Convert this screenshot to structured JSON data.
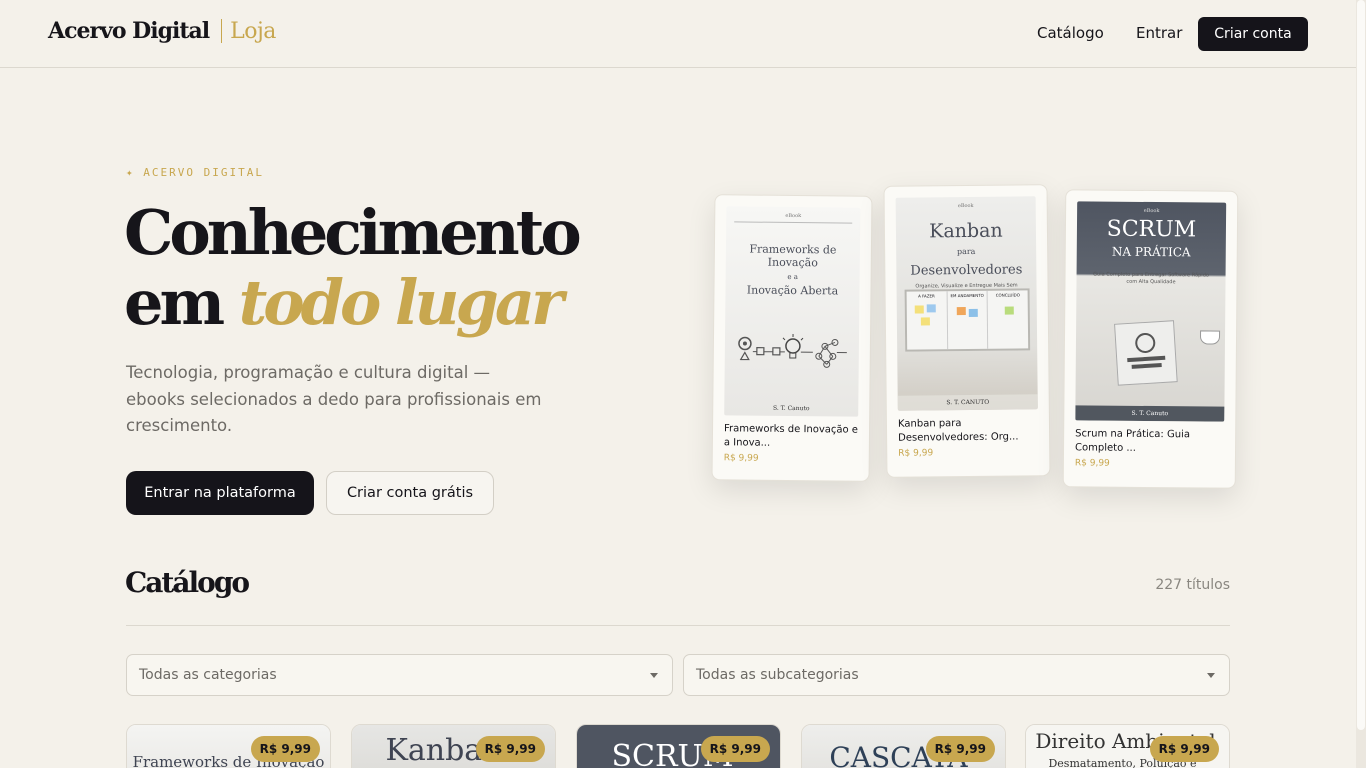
{
  "header": {
    "brand_name": "Acervo Digital",
    "brand_sub": "Loja",
    "nav": [
      {
        "label": "Catálogo"
      },
      {
        "label": "Entrar"
      }
    ],
    "cta_label": "Criar conta"
  },
  "hero": {
    "eyebrow": "✦ ACERVO DIGITAL",
    "title_line1": "Conhecimento",
    "title_line2_plain": "em ",
    "title_line2_accent": "todo lugar",
    "description": "Tecnologia, programação e cultura digital — ebooks selecionados a dedo para profissionais em crescimento.",
    "primary_button": "Entrar na plataforma",
    "secondary_button": "Criar conta grátis"
  },
  "featured": [
    {
      "cover_tag": "eBook",
      "cover_title_a": "Frameworks de Inovação",
      "cover_title_b": "e a",
      "cover_title_c": "Inovação Aberta",
      "cover_author": "S. T. Canuto",
      "title": "Frameworks de Inovação e a Inova...",
      "price": "R$ 9,99"
    },
    {
      "cover_tag": "eBook",
      "cover_title_a": "Kanban",
      "cover_title_b": "para",
      "cover_title_c": "Desenvolvedores",
      "cover_subtitle": "Organize, Visualize e Entregue Mais Sem Caos",
      "board_columns": [
        "A FAZER",
        "EM ANDAMENTO",
        "CONCLUÍDO"
      ],
      "cover_author": "S. T. CANUTO",
      "title": "Kanban para Desenvolvedores: Org...",
      "price": "R$ 9,99"
    },
    {
      "cover_tag": "eBook",
      "cover_title_a": "SCRUM",
      "cover_title_b": "NA PRÁTICA",
      "cover_subtitle": "Guia Completo para Entregar Software Rápido com Alta Qualidade",
      "cover_author": "S. T. Canuto",
      "title": "Scrum na Prática: Guia Completo ...",
      "price": "R$ 9,99"
    }
  ],
  "catalog": {
    "title": "Catálogo",
    "count": "227 títulos",
    "category_placeholder": "Todas as categorias",
    "subcategory_placeholder": "Todas as subcategorias",
    "cards": [
      {
        "thumb_text": "Frameworks de Inovação",
        "price": "R$ 9,99"
      },
      {
        "thumb_text": "Kanban",
        "price": "R$ 9,99"
      },
      {
        "thumb_text": "SCRUM",
        "price": "R$ 9,99"
      },
      {
        "thumb_text": "CASCATA",
        "price": "R$ 9,99"
      },
      {
        "thumb_text": "Direito Ambiental",
        "thumb_sub": "Desmatamento, Poluição e",
        "price": "R$ 9,99"
      }
    ]
  },
  "colors": {
    "background": "#f4f1ea",
    "ink": "#16151a",
    "accent_gold": "#c8a74f",
    "muted": "#6d6a65"
  }
}
